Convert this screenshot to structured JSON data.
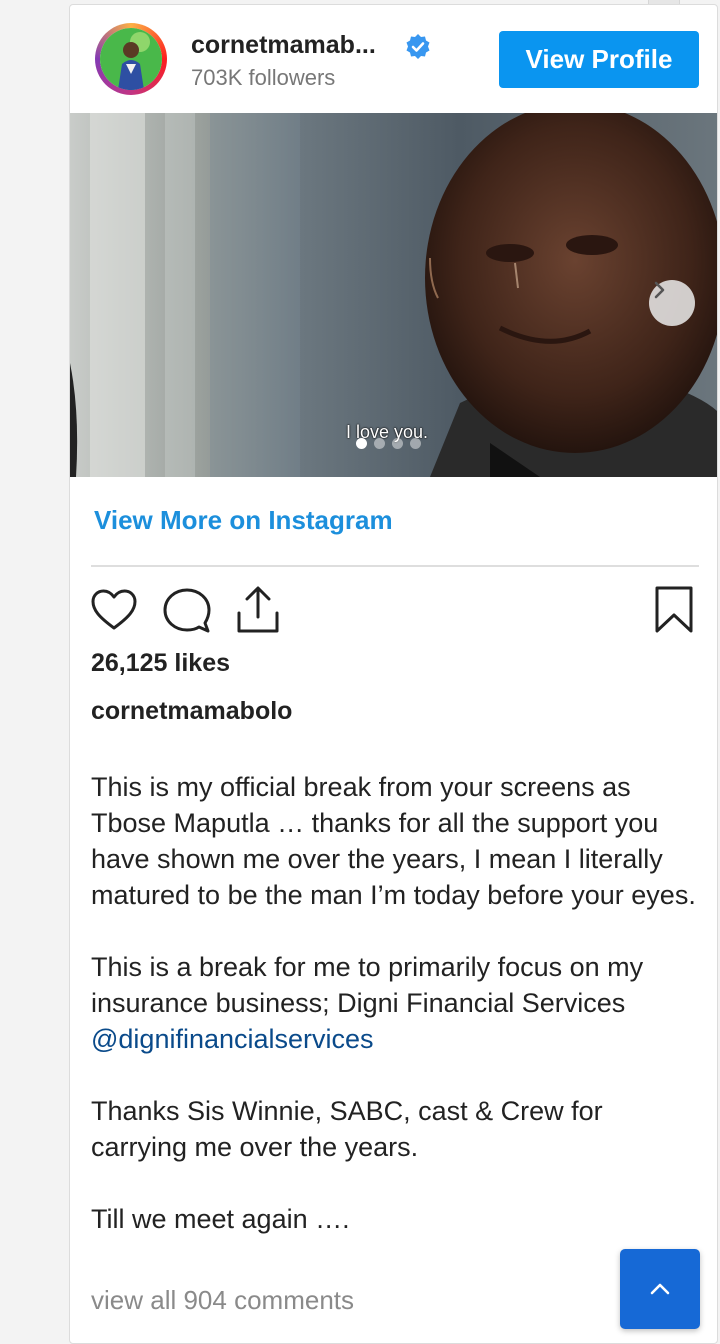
{
  "profile": {
    "username": "cornetmamab...",
    "followers": "703K followers",
    "view_profile_label": "View Profile"
  },
  "media": {
    "subtitle": "I love you.",
    "carousel_dots": 4,
    "active_dot": 1
  },
  "view_more_label": "View More on Instagram",
  "post": {
    "likes": "26,125 likes",
    "caption_user": "cornetmamabolo",
    "paragraph1": "This is my official break from your screens as Tbose Maputla … thanks for all the support you have shown me over the years, I mean I literally matured to be the man I’m today before your eyes.",
    "paragraph2": "This is a break for me to primarily focus on my insurance business; Digni Financial Services",
    "mention": "@dignifinancialservices",
    "paragraph3": "Thanks Sis Winnie, SABC, cast & Crew for carrying me over the years.",
    "paragraph4": "Till we meet again ….",
    "view_comments": "view all 904 comments"
  },
  "icons": [
    "verified-badge-icon",
    "heart-icon",
    "comment-icon",
    "share-icon",
    "bookmark-icon",
    "chevron-right-icon",
    "chevron-up-icon"
  ],
  "colors": {
    "accent": "#0a95f0",
    "link": "#1c8fdc",
    "mention": "#0a4a8a",
    "fab": "#1669d6"
  }
}
